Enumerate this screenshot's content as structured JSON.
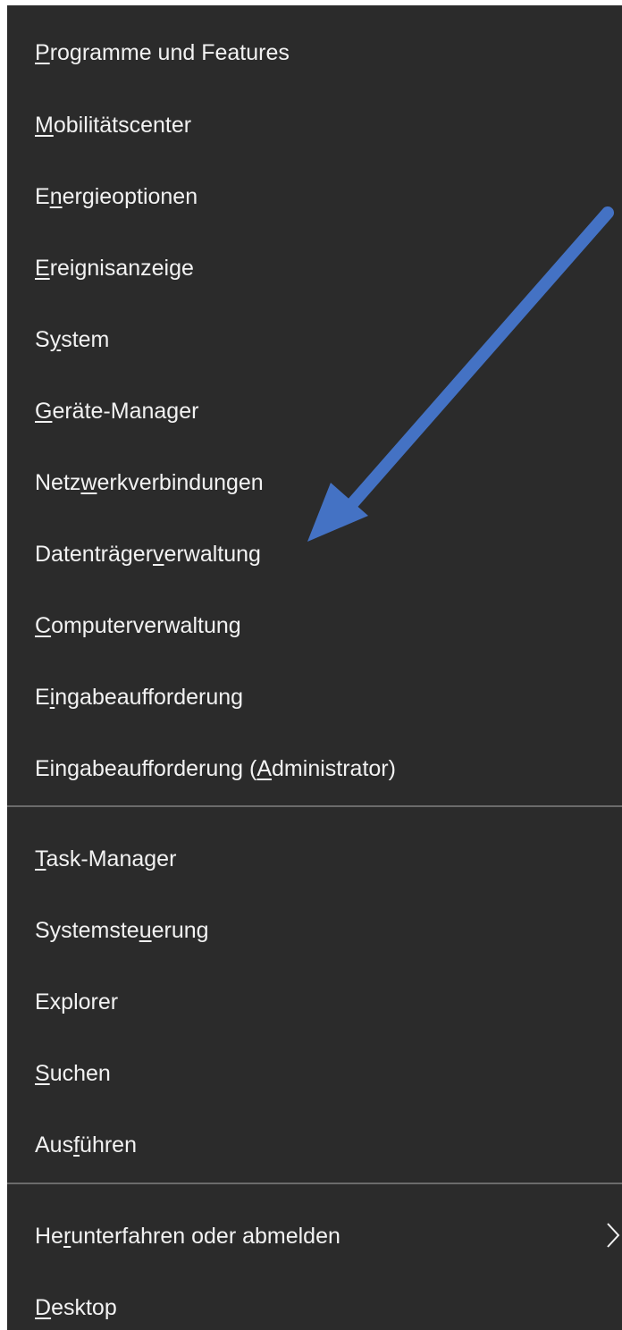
{
  "menu": {
    "items": [
      {
        "pre": "",
        "key": "P",
        "post": "rogramme und Features"
      },
      {
        "pre": "",
        "key": "M",
        "post": "obilitätscenter"
      },
      {
        "pre": "E",
        "key": "n",
        "post": "ergieoptionen"
      },
      {
        "pre": "",
        "key": "E",
        "post": "reignisanzeige"
      },
      {
        "pre": "S",
        "key": "y",
        "post": "stem"
      },
      {
        "pre": "",
        "key": "G",
        "post": "eräte-Manager"
      },
      {
        "pre": "Netz",
        "key": "w",
        "post": "erkverbindungen"
      },
      {
        "pre": "Datenträger",
        "key": "v",
        "post": "erwaltung"
      },
      {
        "pre": "",
        "key": "C",
        "post": "omputerverwaltung"
      },
      {
        "pre": "E",
        "key": "i",
        "post": "ngabeaufforderung"
      },
      {
        "pre": "Eingabeaufforderung (",
        "key": "A",
        "post": "dministrator)"
      },
      {
        "pre": "",
        "key": "T",
        "post": "ask-Manager"
      },
      {
        "pre": "Systemste",
        "key": "u",
        "post": "erung"
      },
      {
        "pre": "Explorer",
        "key": "",
        "post": ""
      },
      {
        "pre": "",
        "key": "S",
        "post": "uchen"
      },
      {
        "pre": "Aus",
        "key": "f",
        "post": "ühren"
      },
      {
        "pre": "He",
        "key": "r",
        "post": "unterfahren oder abmelden"
      },
      {
        "pre": "",
        "key": "D",
        "post": "esktop"
      }
    ],
    "submenu_item_index": 16,
    "submenu_icon": "chevron-right-icon"
  },
  "annotation": {
    "icon": "arrow-icon",
    "color": "#4472c4",
    "points_to_item_index": 7
  },
  "colors": {
    "menu_background": "#2b2b2b",
    "text": "#f2f2f2",
    "divider": "#6b6b6b"
  }
}
